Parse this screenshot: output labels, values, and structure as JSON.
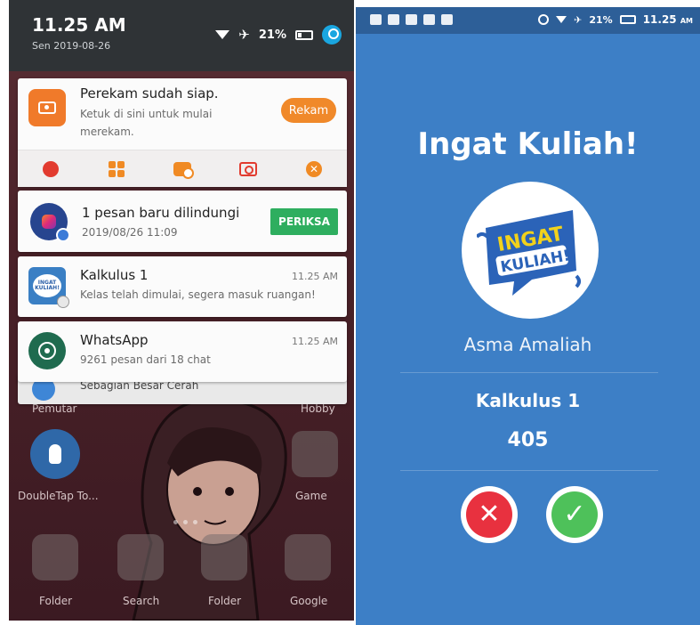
{
  "left": {
    "status": {
      "time": "11.25 AM",
      "date": "Sen 2019-08-26",
      "battery": "21%"
    },
    "recorder_notification": {
      "title": "Perekam sudah siap.",
      "body": "Ketuk di sini untuk mulai merekam.",
      "action": "Rekam"
    },
    "secure_notification": {
      "title": "1 pesan baru dilindungi",
      "timestamp": "2019/08/26 11:09",
      "action": "PERIKSA"
    },
    "kalkulus_notification": {
      "title": "Kalkulus 1",
      "body": "Kelas telah dimulai, segera masuk ruangan!",
      "time": "11.25 AM",
      "icon_text": "INGAT KULIAH!"
    },
    "whatsapp_notification": {
      "title": "WhatsApp",
      "body": "9261 pesan dari 18 chat",
      "time": "11.25 AM"
    },
    "weather_notification": {
      "body": "Sebagian Besar Cerah"
    },
    "homescreen": {
      "labels": {
        "pemutar": "Pemutar",
        "hobby": "Hobby",
        "doubletap": "DoubleTap To...",
        "game": "Game",
        "folder1": "Folder",
        "search": "Search",
        "folder2": "Folder",
        "google": "Google"
      }
    }
  },
  "right": {
    "status": {
      "battery": "21%",
      "time": "11.25",
      "ampm": "AM"
    },
    "app_title": "Ingat Kuliah!",
    "logo_text": [
      "INGAT",
      "KULIAH!"
    ],
    "user_name": "Asma Amaliah",
    "course_name": "Kalkulus 1",
    "course_code": "405",
    "reject_symbol": "✕",
    "accept_symbol": "✓"
  },
  "colors": {
    "right_bg": "#3d7fc6",
    "reject": "#e8313f",
    "accept": "#4ec15a",
    "periksa": "#2eae5f",
    "rekam": "#f0892a"
  }
}
